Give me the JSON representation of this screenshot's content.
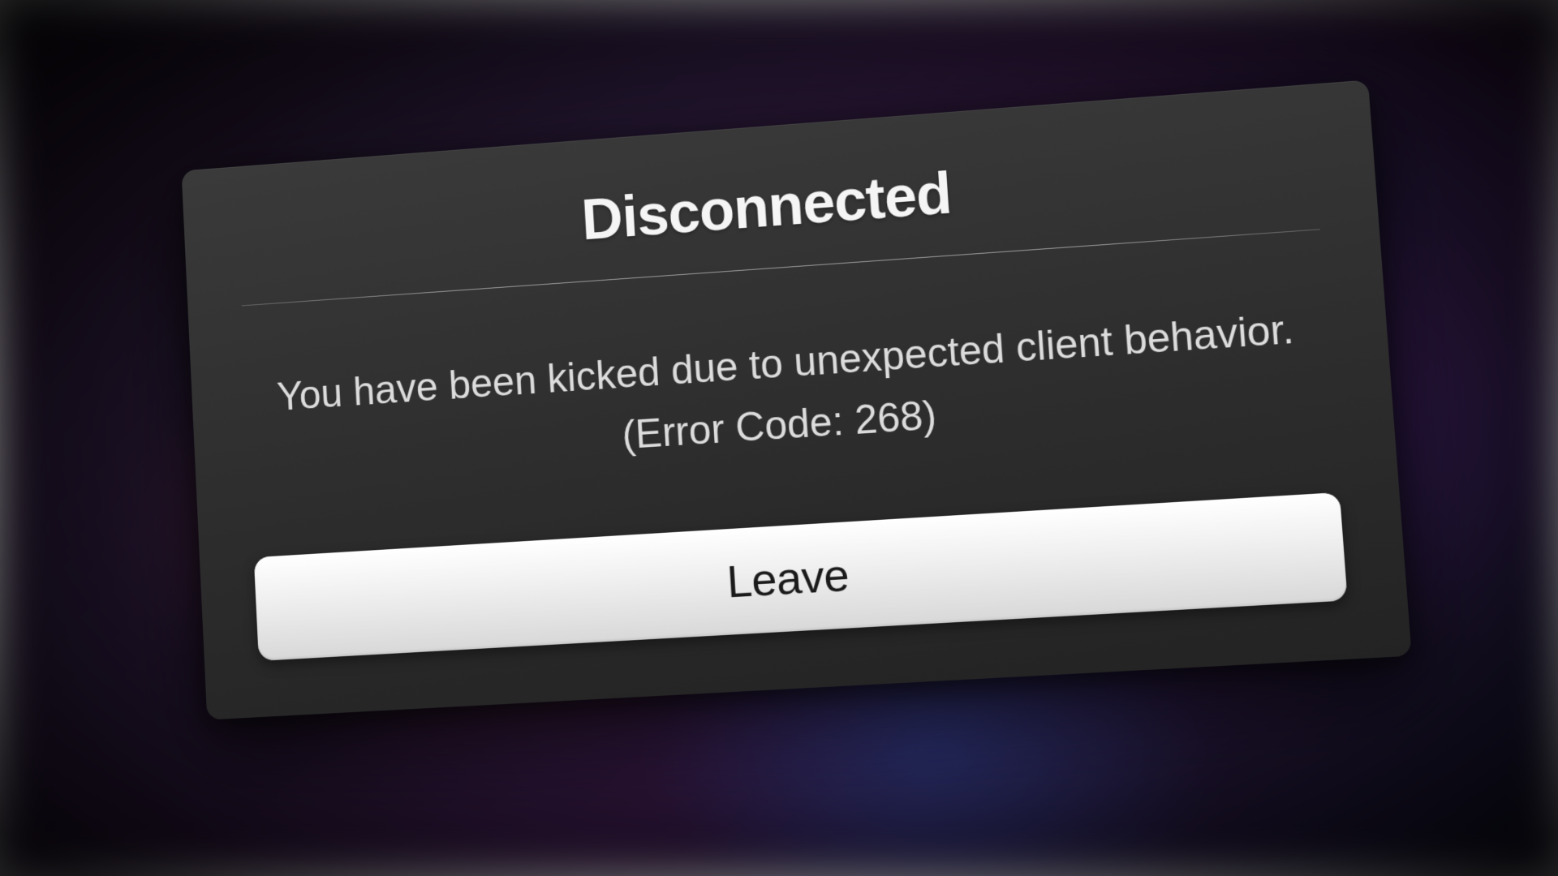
{
  "dialog": {
    "title": "Disconnected",
    "message": "You have been kicked due to unexpected client behavior.",
    "error_code_text": "(Error Code: 268)",
    "button_label": "Leave"
  }
}
